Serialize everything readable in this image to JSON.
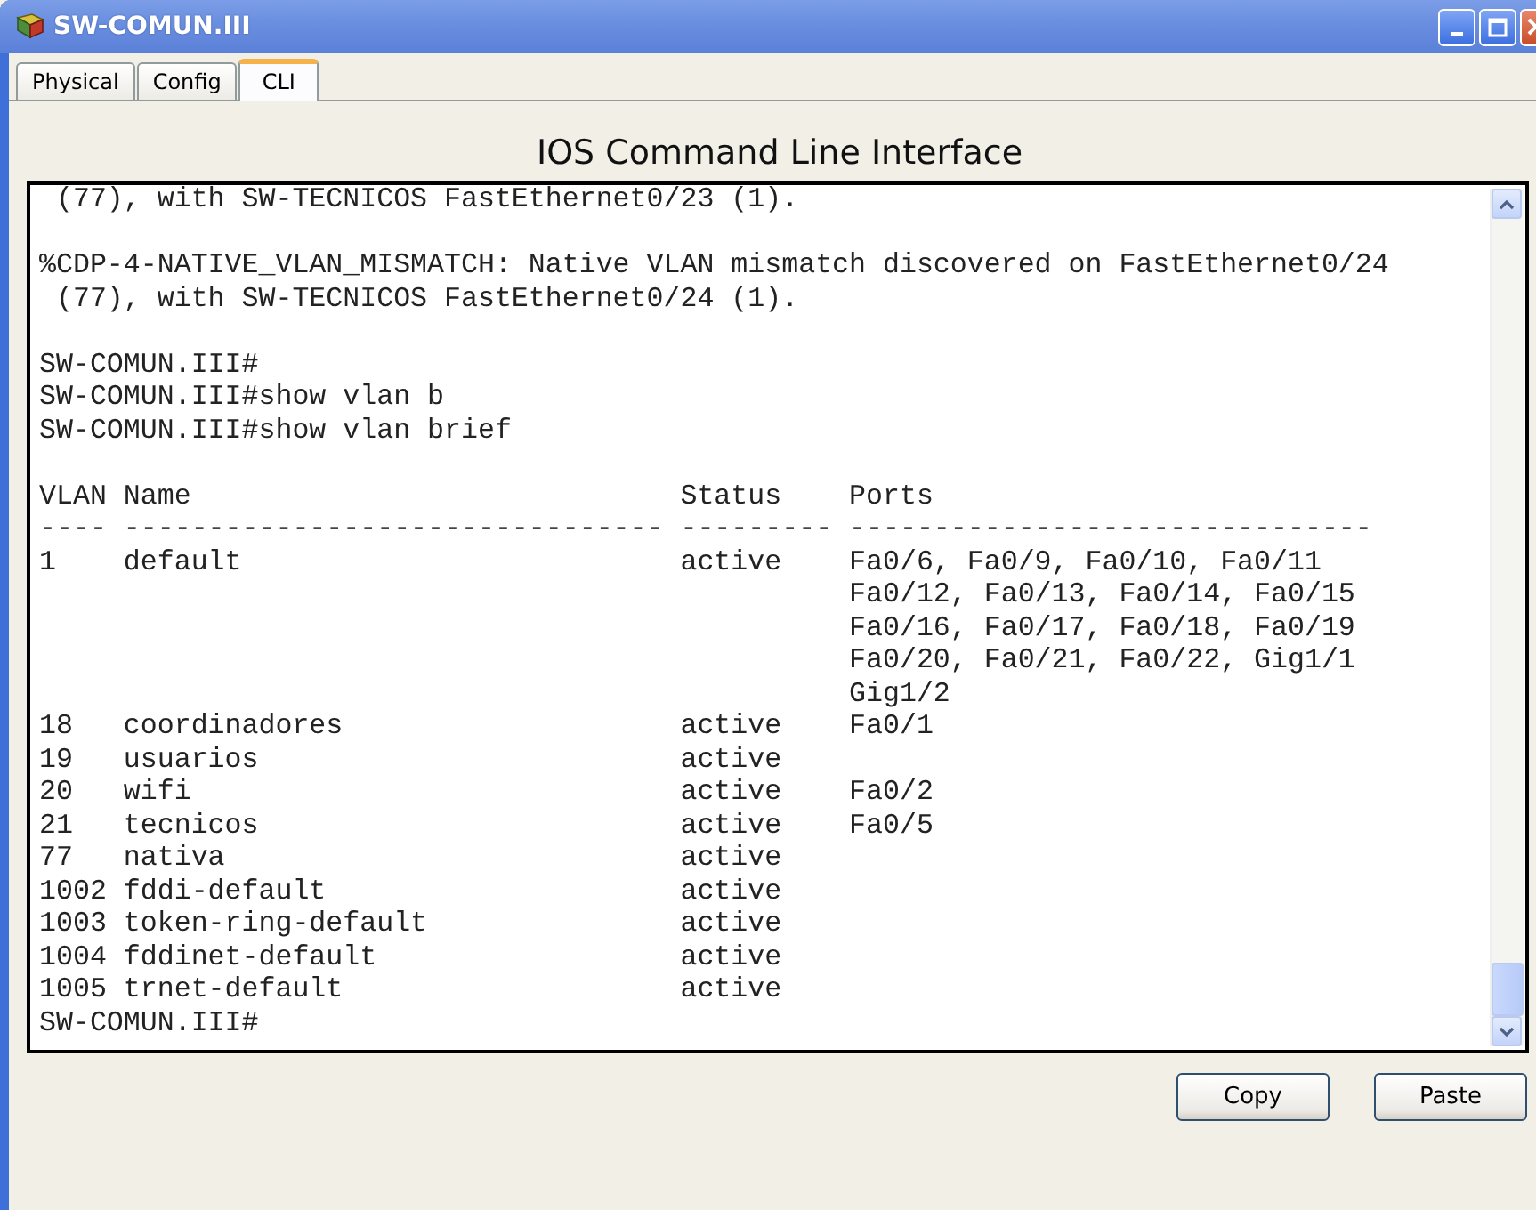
{
  "window": {
    "title": "SW-COMUN.III"
  },
  "tabs": [
    {
      "label": "Physical",
      "selected": false
    },
    {
      "label": "Config",
      "selected": false
    },
    {
      "label": "CLI",
      "selected": true
    }
  ],
  "heading": "IOS Command Line Interface",
  "terminal": {
    "blocks": [
      [
        " (77), with SW-TECNICOS FastEthernet0/23 (1)."
      ],
      [
        "%CDP-4-NATIVE_VLAN_MISMATCH: Native VLAN mismatch discovered on FastEthernet0/24",
        " (77), with SW-TECNICOS FastEthernet0/24 (1)."
      ],
      [
        "SW-COMUN.III#",
        "SW-COMUN.III#show vlan b",
        "SW-COMUN.III#show vlan brief"
      ],
      [
        "VLAN Name                             Status    Ports",
        "---- -------------------------------- --------- -------------------------------",
        "1    default                          active    Fa0/6, Fa0/9, Fa0/10, Fa0/11",
        "                                                Fa0/12, Fa0/13, Fa0/14, Fa0/15",
        "                                                Fa0/16, Fa0/17, Fa0/18, Fa0/19",
        "                                                Fa0/20, Fa0/21, Fa0/22, Gig1/1",
        "                                                Gig1/2",
        "18   coordinadores                    active    Fa0/1",
        "19   usuarios                         active",
        "20   wifi                             active    Fa0/2",
        "21   tecnicos                         active    Fa0/5",
        "77   nativa                           active",
        "1002 fddi-default                     active",
        "1003 token-ring-default               active",
        "1004 fddinet-default                  active",
        "1005 trnet-default                    active",
        "SW-COMUN.III#"
      ]
    ]
  },
  "buttons": [
    {
      "label": "Copy"
    },
    {
      "label": "Paste"
    }
  ]
}
